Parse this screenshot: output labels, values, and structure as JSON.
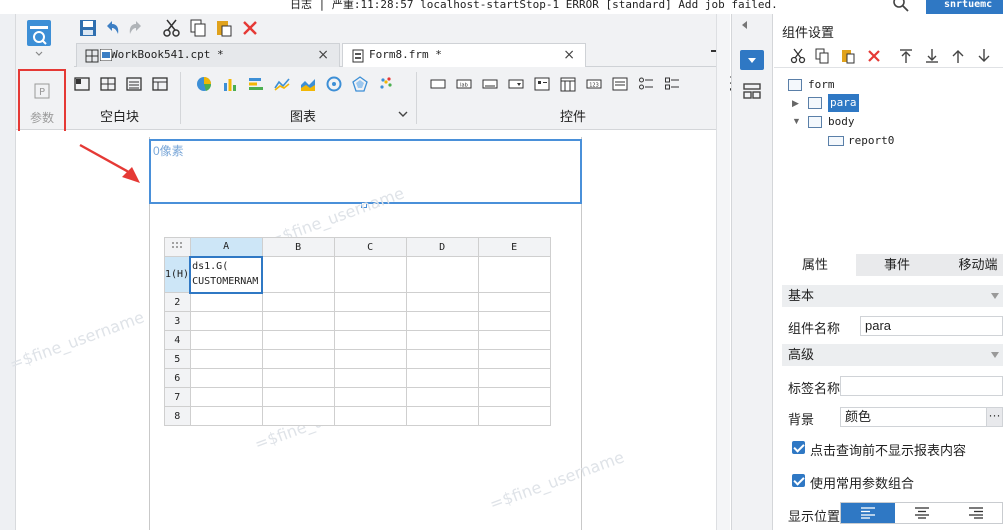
{
  "status_bar": {
    "log_text": "日志 | 严重:11:28:57 localhost-startStop-1 ERROR [standard] Add job failed.",
    "user": "snrtuemc"
  },
  "tabs": [
    {
      "label": "WorkBook541.cpt *",
      "active": false
    },
    {
      "label": "Form8.frm *",
      "active": true
    }
  ],
  "left_param": {
    "label": "参数",
    "icon": "P"
  },
  "ribbon": {
    "groups": [
      {
        "label": "空白块"
      },
      {
        "label": "图表"
      },
      {
        "label": "控件"
      }
    ]
  },
  "canvas": {
    "para_placeholder": "0像素",
    "watermark": "=$fine_username",
    "columns": [
      "A",
      "B",
      "C",
      "D",
      "E"
    ],
    "rows": [
      "1(H)",
      "2",
      "3",
      "4",
      "5",
      "6",
      "7",
      "8"
    ],
    "cell_a1": "ds1.G( CUSTOMERNAM"
  },
  "right_panel": {
    "title": "组件设置",
    "tree": [
      {
        "label": "form",
        "level": 0,
        "selected": false
      },
      {
        "label": "para",
        "level": 1,
        "selected": true
      },
      {
        "label": "body",
        "level": 1,
        "selected": false
      },
      {
        "label": "report0",
        "level": 2,
        "selected": false
      }
    ],
    "prop_tabs": [
      "属性",
      "事件",
      "移动端"
    ],
    "section_basic": "基本",
    "component_name_label": "组件名称",
    "component_name_value": "para",
    "section_advanced": "高级",
    "tag_name_label": "标签名称",
    "tag_name_value": "",
    "background_label": "背景",
    "background_value": "颜色",
    "check1": "点击查询前不显示报表内容",
    "check2": "使用常用参数组合",
    "display_position_label": "显示位置"
  },
  "colors": {
    "accent": "#2f78c4",
    "highlight_border": "#e53935"
  }
}
